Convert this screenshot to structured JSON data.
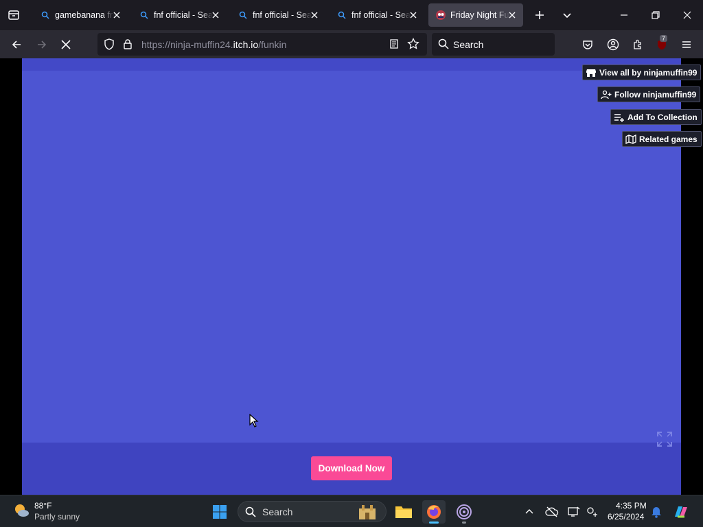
{
  "browser": {
    "tabs": [
      {
        "label": "gamebanana fnf",
        "icon": "search-icon"
      },
      {
        "label": "fnf official - Search",
        "icon": "search-icon"
      },
      {
        "label": "fnf official - Search",
        "icon": "search-icon"
      },
      {
        "label": "fnf official - Search",
        "icon": "search-icon"
      },
      {
        "label": "Friday Night Funkin",
        "icon": "fnf-favicon",
        "active": true
      }
    ],
    "url_prefix": "https://ninja-muffin24.",
    "url_host": "itch.io",
    "url_path": "/funkin",
    "search_placeholder": "Search",
    "extension_badge": "7"
  },
  "page": {
    "side_buttons": [
      {
        "label": "View all by ninjamuffin99",
        "icon": "itchio-icon"
      },
      {
        "label": "Follow ninjamuffin99",
        "icon": "add-user-icon"
      },
      {
        "label": "Add To Collection",
        "icon": "add-list-icon"
      },
      {
        "label": "Related games",
        "icon": "map-icon"
      }
    ],
    "download_label": "Download Now"
  },
  "taskbar": {
    "weather_temp": "88°F",
    "weather_desc": "Partly sunny",
    "search_placeholder": "Search",
    "time": "4:35 PM",
    "date": "6/25/2024"
  },
  "colors": {
    "game_bg": "#4d55d2",
    "page_bg": "#3f44c0",
    "download_btn": "#fa4a96"
  }
}
